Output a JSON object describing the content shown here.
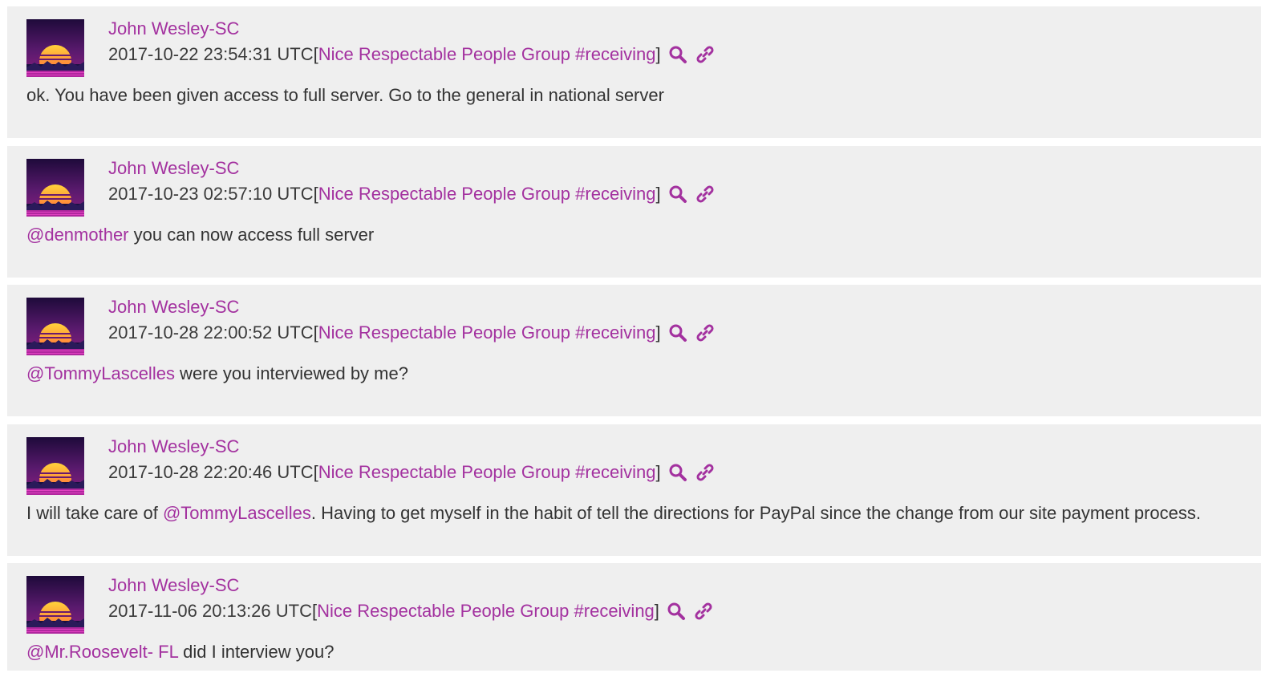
{
  "colors": {
    "accent": "#a3319f",
    "card_bg": "#efefef",
    "text": "#333333"
  },
  "messages": [
    {
      "author": "John Wesley-SC",
      "timestamp": "2017-10-22 23:54:31 UTC",
      "bracket_open": "[",
      "channel": "Nice Respectable People Group #receiving",
      "bracket_close": "]",
      "body": {
        "mention": "",
        "text": "ok. You have been given access to full server. Go to the general in national server",
        "mention2": "",
        "text2": ""
      }
    },
    {
      "author": "John Wesley-SC",
      "timestamp": "2017-10-23 02:57:10 UTC",
      "bracket_open": "[",
      "channel": "Nice Respectable People Group #receiving",
      "bracket_close": "]",
      "body": {
        "mention": "@denmother",
        "text": " you can now access full server",
        "mention2": "",
        "text2": ""
      }
    },
    {
      "author": "John Wesley-SC",
      "timestamp": "2017-10-28 22:00:52 UTC",
      "bracket_open": "[",
      "channel": "Nice Respectable People Group #receiving",
      "bracket_close": "]",
      "body": {
        "mention": "@TommyLascelles",
        "text": " were you interviewed by me?",
        "mention2": "",
        "text2": ""
      }
    },
    {
      "author": "John Wesley-SC",
      "timestamp": "2017-10-28 22:20:46 UTC",
      "bracket_open": "[",
      "channel": "Nice Respectable People Group #receiving",
      "bracket_close": "]",
      "body": {
        "mention": "",
        "text": "I will take care of ",
        "mention2": "@TommyLascelles",
        "text2": ". Having to get myself in the habit of tell the directions for PayPal since the change from our site payment process."
      }
    },
    {
      "author": "John Wesley-SC",
      "timestamp": "2017-11-06 20:13:26 UTC",
      "bracket_open": "[",
      "channel": "Nice Respectable People Group #receiving",
      "bracket_close": "]",
      "body": {
        "mention": "@Mr.Roosevelt- FL",
        "text": " did I interview you?",
        "mention2": "",
        "text2": ""
      }
    }
  ],
  "icons": {
    "search": "search-icon",
    "link": "link-icon",
    "avatar": "sunset-avatar"
  }
}
